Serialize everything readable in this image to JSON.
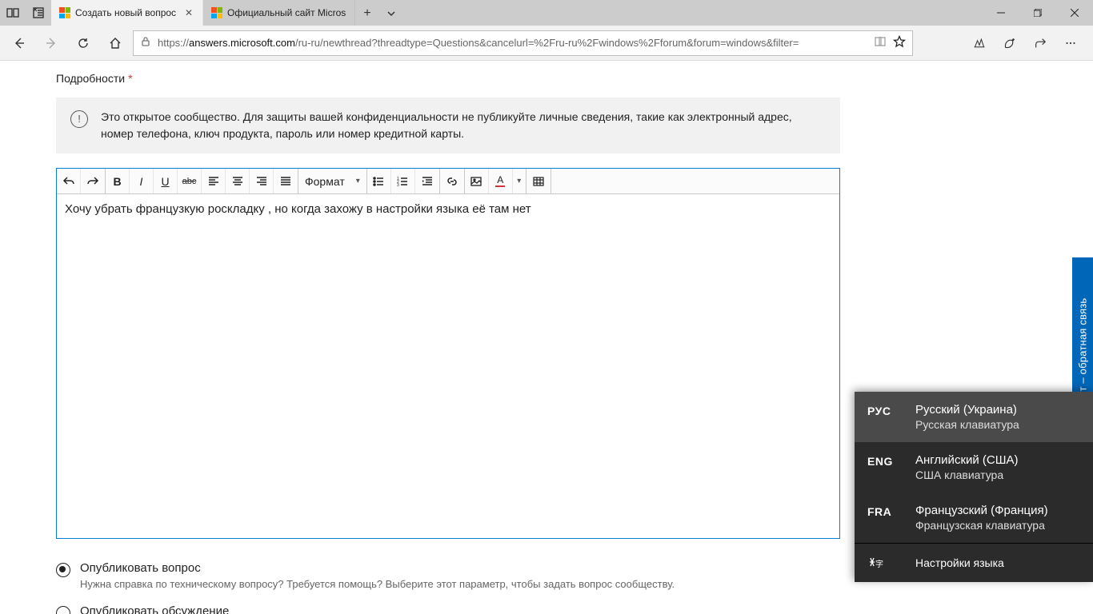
{
  "window": {
    "tabs": [
      {
        "title": "Создать новый вопрос",
        "active": true
      },
      {
        "title": "Официальный сайт Micros",
        "active": false
      }
    ]
  },
  "addressbar": {
    "scheme": "https://",
    "host": "answers.microsoft.com",
    "path": "/ru-ru/newthread?threadtype=Questions&cancelurl=%2Fru-ru%2Fwindows%2Fforum&forum=windows&filter="
  },
  "page": {
    "details_label": "Подробности",
    "required_marker": "*",
    "privacy_notice": "Это открытое сообщество. Для защиты вашей конфиденциальности не публикуйте личные сведения, такие как электронный адрес, номер телефона, ключ продукта, пароль или номер кредитной карты.",
    "toolbar": {
      "format_label": "Формат"
    },
    "editor_text": "Хочу убрать французкую роскладку , но когда захожу в настройки языка её там нет",
    "publish": {
      "question": {
        "title": "Опубликовать вопрос",
        "desc": "Нужна справка по техническому вопросу? Требуется помощь? Выберите этот параметр, чтобы задать вопрос сообществу."
      },
      "discussion": {
        "title": "Опубликовать обсуждение"
      }
    },
    "feedback_tab": "йт – обратная связь"
  },
  "ime": {
    "items": [
      {
        "code": "РУС",
        "name": "Русский (Украина)",
        "kb": "Русская клавиатура",
        "active": true
      },
      {
        "code": "ENG",
        "name": "Английский (США)",
        "kb": "США клавиатура",
        "active": false
      },
      {
        "code": "FRA",
        "name": "Французский (Франция)",
        "kb": "Французская клавиатура",
        "active": false
      }
    ],
    "settings": "Настройки языка"
  }
}
